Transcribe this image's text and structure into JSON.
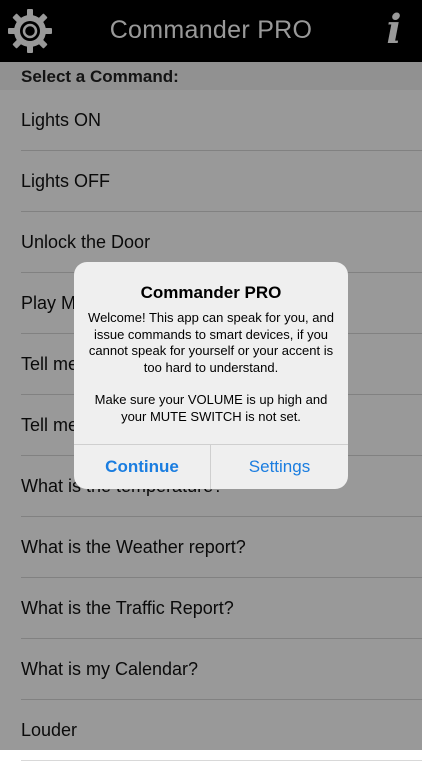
{
  "navbar": {
    "title": "Commander PRO",
    "settings_icon": "gear-icon",
    "info_icon": "info-icon",
    "info_glyph": "i"
  },
  "section_header": "Select a Command:",
  "commands": [
    "Lights ON",
    "Lights OFF",
    "Unlock the Door",
    "Play Music",
    "Tell me a joke",
    "Tell me the news",
    "What is the temperature?",
    "What is the Weather report?",
    "What is the Traffic Report?",
    "What is my Calendar?",
    "Louder"
  ],
  "alert": {
    "title": "Commander PRO",
    "message_1": "Welcome! This app can speak for you, and issue commands to smart devices, if you cannot speak for yourself or your accent is too hard to understand.",
    "message_2": "Make sure your VOLUME is up high and your MUTE SWITCH is not set.",
    "continue_label": "Continue",
    "settings_label": "Settings"
  },
  "colors": {
    "navbar": "#000000",
    "accent": "#1a7de0",
    "overlay": "rgba(0,0,0,0.40)"
  }
}
